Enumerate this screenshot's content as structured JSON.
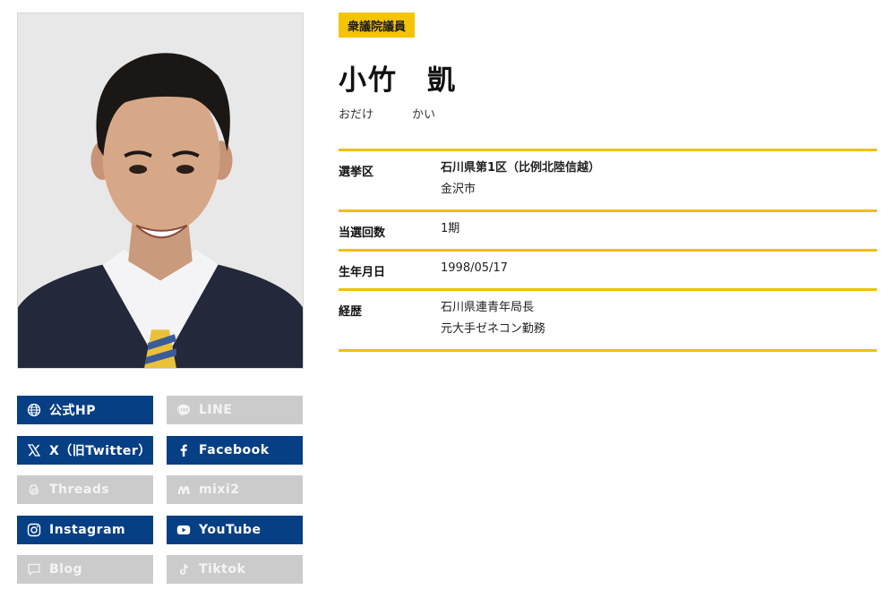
{
  "badge": "衆議院議員",
  "name": "小竹　凱",
  "kana": {
    "family": "おだけ",
    "given": "かい"
  },
  "profile": {
    "district_label": "選挙区",
    "district_line1": "石川県第1区（比例北陸信越）",
    "district_line2": "金沢市",
    "terms_label": "当選回数",
    "terms_value": "1期",
    "birthday_label": "生年月日",
    "birthday_value": "1998/05/17",
    "career_label": "経歴",
    "career_line1": "石川県連青年局長",
    "career_line2": "元大手ゼネコン勤務"
  },
  "sns": {
    "official_hp": "公式HP",
    "line": "LINE",
    "x_twitter": "X（旧Twitter）",
    "facebook": "Facebook",
    "threads": "Threads",
    "mixi2": "mixi2",
    "instagram": "Instagram",
    "youtube": "YouTube",
    "blog": "Blog",
    "tiktok": "Tiktok"
  },
  "colors": {
    "accent": "#f0c000",
    "active_button": "#073f84",
    "inactive_button": "#cbcbcb"
  }
}
